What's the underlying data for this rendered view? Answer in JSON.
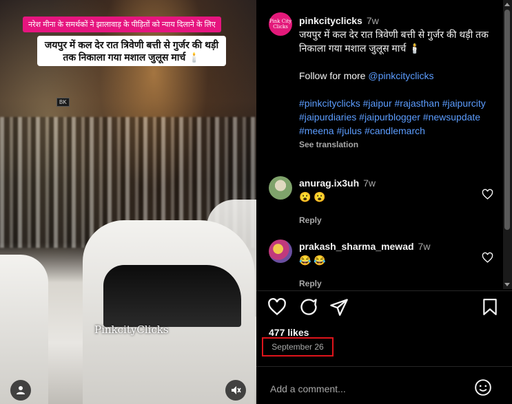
{
  "media": {
    "banner_top": "नरेश मीना के समर्थकों ने झालावाड़ के पीड़ितों को न्याय दिलाने के लिए",
    "banner_main": "जयपुर में कल देर रात त्रिवेणी बत्ती से गुर्जर की थड़ी तक निकाला गया मशाल जुलूस मार्च 🕯️",
    "watermark": "PinkcityClicks",
    "sign_text": "BK"
  },
  "post": {
    "username": "pinkcityclicks",
    "time": "7w",
    "caption_line1": "जयपुर में कल देर रात त्रिवेणी बत्ती से गुर्जर की थड़ी तक निकाला गया मशाल जुलूस मार्च 🕯️",
    "follow_text": "Follow for more ",
    "follow_handle": "@pinkcityclicks",
    "hashtags": "#pinkcityclicks #jaipur #rajasthan #jaipurcity #jaipurdiaries #jaipurblogger #newsupdate #meena #julus #candlemarch",
    "see_translation": "See translation",
    "avatar_text": "Pink City Clicks"
  },
  "comments": [
    {
      "username": "anurag.ix3uh",
      "time": "7w",
      "text": "😮 😮",
      "reply": "Reply"
    },
    {
      "username": "prakash_sharma_mewad",
      "time": "7w",
      "text": "😂 😂",
      "reply": "Reply"
    }
  ],
  "stats": {
    "likes": "477 likes",
    "date": "September 26"
  },
  "add_comment": {
    "placeholder": "Add a comment..."
  },
  "colors": {
    "accent_link": "#5c9dff",
    "banner_pink": "#e6157f",
    "highlight_red": "#e0141b"
  }
}
